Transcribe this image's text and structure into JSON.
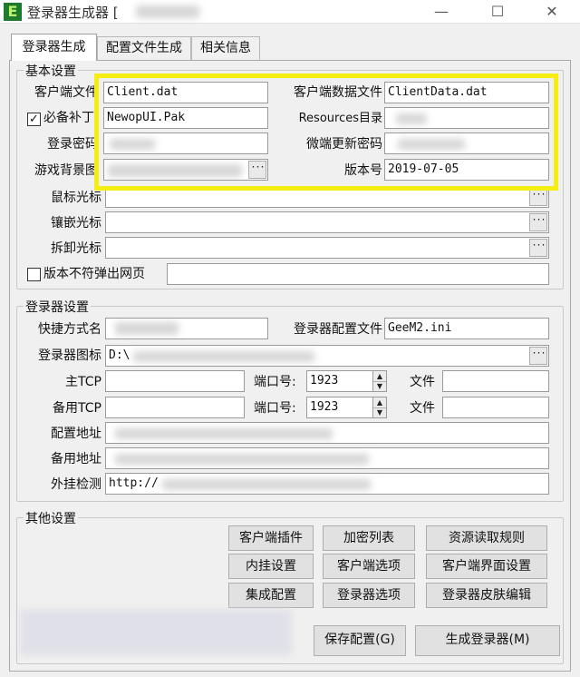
{
  "window": {
    "title": "登录器生成器 [",
    "minimize_glyph": "—",
    "maximize_glyph": "☐",
    "close_glyph": "✕",
    "app_icon_letter": "E"
  },
  "tabs": [
    {
      "label": "登录器生成",
      "active": true
    },
    {
      "label": "配置文件生成",
      "active": false
    },
    {
      "label": "相关信息",
      "active": false
    }
  ],
  "basic": {
    "title": "基本设置",
    "client_file_label": "客户端文件",
    "client_file_value": "Client.dat",
    "client_data_label": "客户端数据文件",
    "client_data_value": "ClientData.dat",
    "patch_label": "必备补丁",
    "patch_checked": true,
    "patch_value": "NewopUI.Pak",
    "resources_label": "Resources目录",
    "login_pwd_label": "登录密码",
    "micro_pwd_label": "微端更新密码",
    "bg_label": "游戏背景图",
    "version_label": "版本号",
    "version_value": "2019-07-05",
    "cursor_label": "鼠标光标",
    "inlay_label": "镶嵌光标",
    "remove_label": "拆卸光标",
    "popup_label": "版本不符弹出网页",
    "popup_checked": false,
    "browse_glyph": "···"
  },
  "launcher": {
    "title": "登录器设置",
    "shortcut_label": "快捷方式名",
    "config_label": "登录器配置文件",
    "config_value": "GeeM2.ini",
    "icon_label": "登录器图标",
    "icon_value": "D:\\",
    "main_tcp_label": "主TCP",
    "backup_tcp_label": "备用TCP",
    "port_label": "端口号:",
    "main_port_value": "1923",
    "backup_port_value": "1923",
    "file_label": "文件",
    "config_url_label": "配置地址",
    "backup_url_label": "备用地址",
    "plugin_check_label": "外挂检测",
    "plugin_check_value": "http://",
    "spin_up": "▲",
    "spin_down": "▼"
  },
  "other": {
    "title": "其他设置",
    "buttons": [
      "客户端插件",
      "加密列表",
      "资源读取规则",
      "内挂设置",
      "客户端选项",
      "客户端界面设置",
      "集成配置",
      "登录器选项",
      "登录器皮肤编辑"
    ],
    "save_label": "保存配置(G)",
    "generate_label": "生成登录器(M)"
  }
}
